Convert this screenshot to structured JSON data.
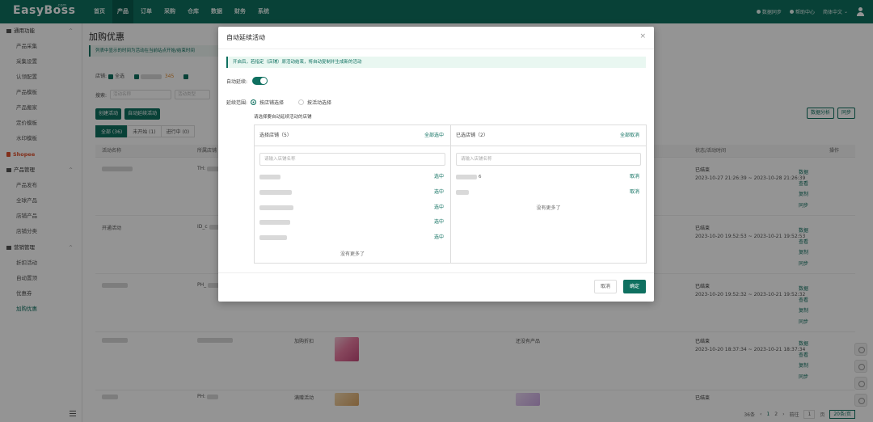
{
  "app": {
    "logo": "EasyBoss",
    "logo_sup": ".com"
  },
  "topnav": {
    "items": [
      "首页",
      "产品",
      "订单",
      "采购",
      "仓库",
      "数据",
      "财务",
      "系统"
    ],
    "active_index": 1,
    "right": {
      "sync": "数据同步",
      "help": "帮助中心",
      "lang": "简体中文"
    }
  },
  "sidebar": {
    "group1": "通用功能",
    "group1_items": [
      "产品采集",
      "采集设置",
      "认领配置",
      "产品模板",
      "产品搬家",
      "定价模板",
      "水印模板"
    ],
    "shop": "Shopee",
    "group2": "产品管理",
    "group2_items": [
      "产品发布",
      "全球产品",
      "店铺产品",
      "店铺分类"
    ],
    "group3": "营销管理",
    "group3_items": [
      "折扣活动",
      "自动置顶",
      "优惠券",
      "加购优惠"
    ]
  },
  "page": {
    "title": "加购优惠",
    "notice": "列表中显示的时间为活动在当前站点开始/结束时间",
    "filter_label": "店铺:",
    "filter_all": "全选",
    "filter_badge": "345",
    "search_label": "搜索:",
    "search_placeholder": "活动名称",
    "type_placeholder": "活动类型",
    "btn_create": "创建活动",
    "btn_auto": "自动延续活动",
    "btn_analysis": "数据分析",
    "btn_sync": "同步",
    "tabs": [
      "全部 (36)",
      "未开始 (1)",
      "进行中 (0)"
    ],
    "table_headers": {
      "name": "活动名称",
      "shop": "所属店铺",
      "status": "状态/活动时间",
      "ops": "操作"
    },
    "rows": [
      {
        "shop": "TH:",
        "status": "已结束",
        "time": "2023-10-27 21:26:39 ~ 2023-10-28 21:26:39"
      },
      {
        "name": "开通活动",
        "shop": "ID_c",
        "status": "已结束",
        "time": "2023-10-20 19:52:53 ~ 2023-10-21 19:52:53"
      },
      {
        "shop": "PH_",
        "status": "已结束",
        "time": "2023-10-20 19:52:32 ~ 2023-10-21 19:52:32"
      },
      {
        "type": "加购折扣",
        "product": "还没有产品",
        "status": "已结束",
        "time": "2023-10-20 18:37:34 ~ 2023-10-21 18:37:34"
      },
      {
        "shop": "PH:",
        "type": "满赠活动",
        "status": "已结束"
      }
    ],
    "ops": [
      "数据",
      "查看",
      "复制",
      "同步"
    ],
    "pager": {
      "total": "36条",
      "p1": "1",
      "p2": "2",
      "goto": "前往",
      "cur": "1",
      "page_unit": "页",
      "size": "20条/页"
    }
  },
  "modal": {
    "title": "自动延续活动",
    "close": "×",
    "tip": "开启后，若指定（店铺）原活动结束，将自动复制并生成新的活动",
    "auto_label": "自动延续:",
    "scope_label": "延续范围:",
    "scope_opt1": "按店铺选择",
    "scope_opt2": "按活动选择",
    "hint": "请选择要自动延续活动的店铺",
    "left_title": "选择店铺（5）",
    "left_action": "全部选中",
    "right_title": "已选店铺（2）",
    "right_action": "全部取消",
    "search_placeholder": "请输入店铺名称",
    "left_items": [
      {
        "action": "选中"
      },
      {
        "action": "选中"
      },
      {
        "action": "选中"
      },
      {
        "action": "选中"
      },
      {
        "action": "选中"
      }
    ],
    "right_items": [
      {
        "suffix": "6",
        "action": "取消"
      },
      {
        "action": "取消"
      }
    ],
    "no_more": "没有更多了",
    "cancel": "取消",
    "ok": "确定"
  }
}
